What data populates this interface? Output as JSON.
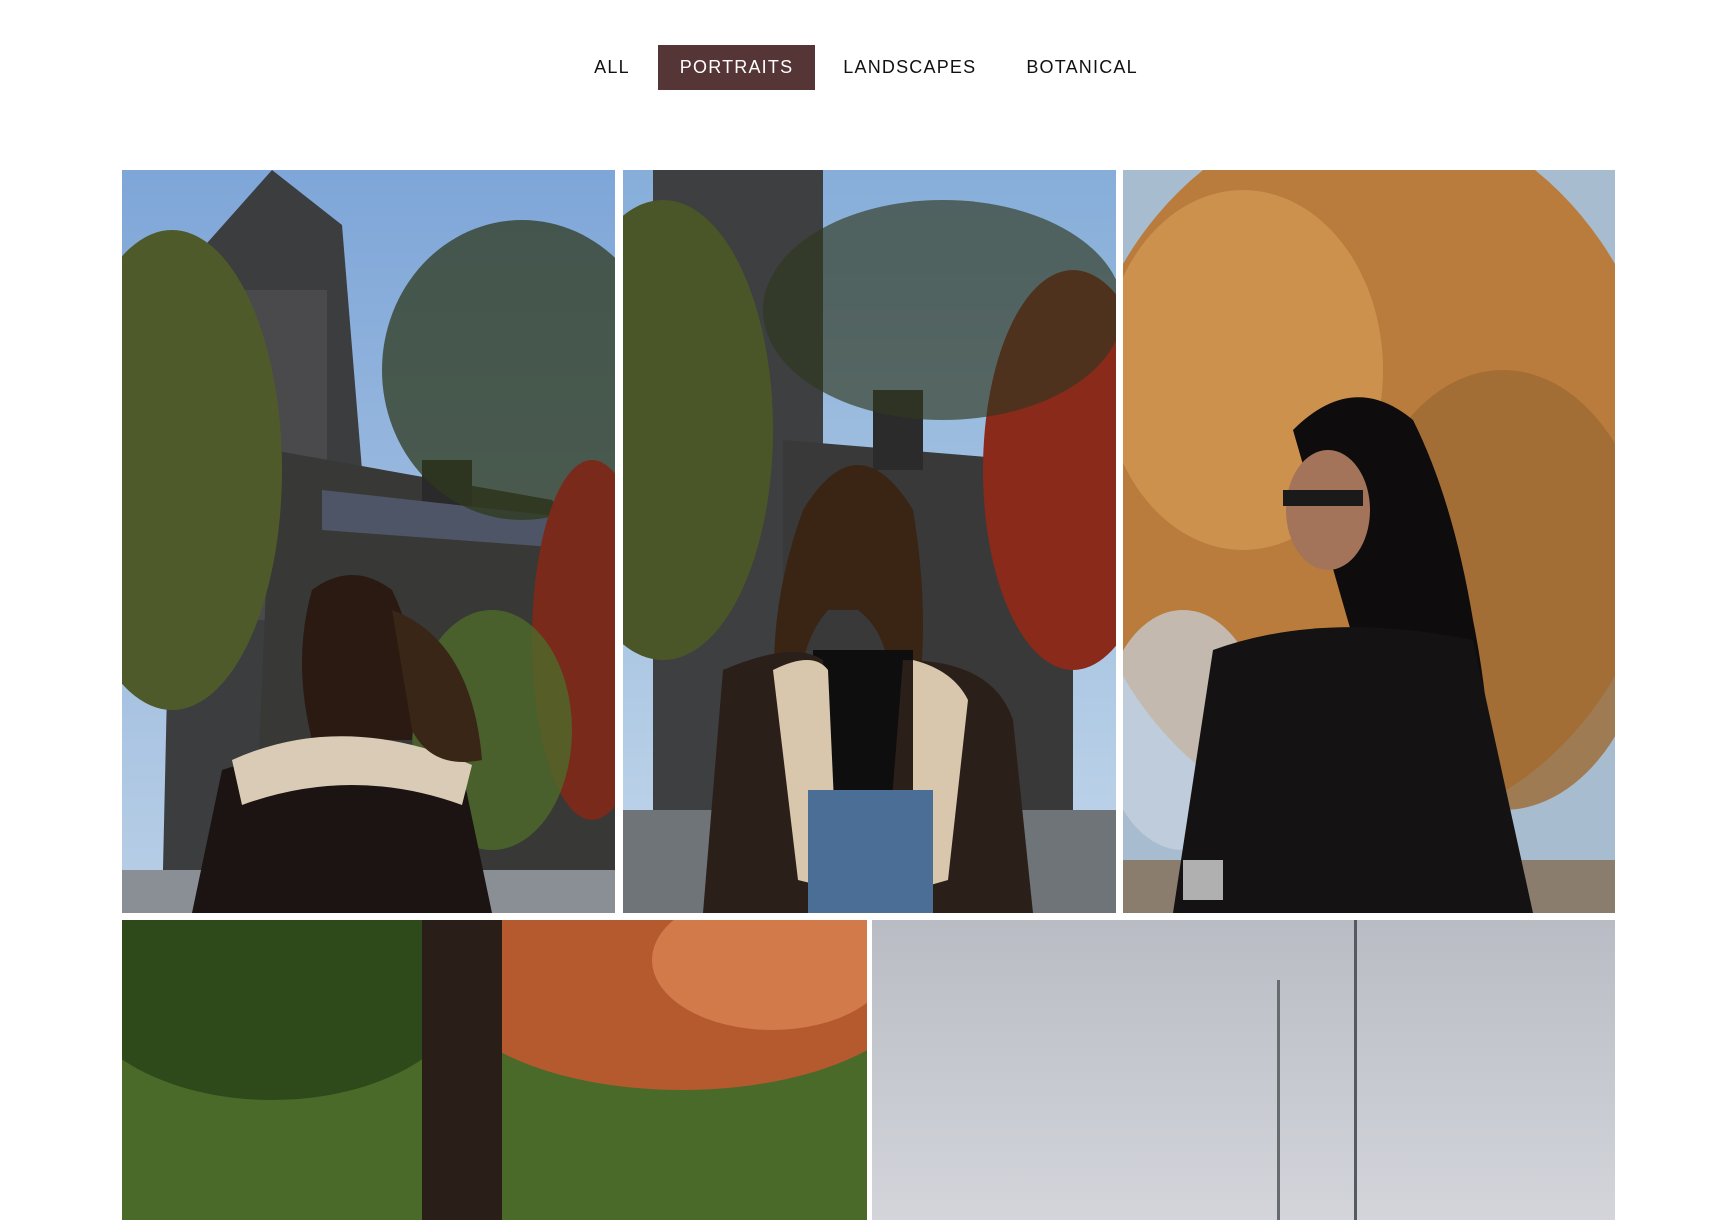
{
  "filters": {
    "items": [
      {
        "label": "ALL",
        "active": false
      },
      {
        "label": "PORTRAITS",
        "active": true
      },
      {
        "label": "LANDSCAPES",
        "active": false
      },
      {
        "label": "BOTANICAL",
        "active": false
      }
    ],
    "active_color": "#553535"
  },
  "gallery": {
    "photos": [
      {
        "subject": "woman-hair-blowing-by-stone-building"
      },
      {
        "subject": "woman-smiling-shearling-jacket"
      },
      {
        "subject": "woman-profile-glasses-autumn-tree"
      },
      {
        "subject": "autumn-foliage-tree-trunk"
      },
      {
        "subject": "overcast-sky-waterfront"
      }
    ]
  }
}
